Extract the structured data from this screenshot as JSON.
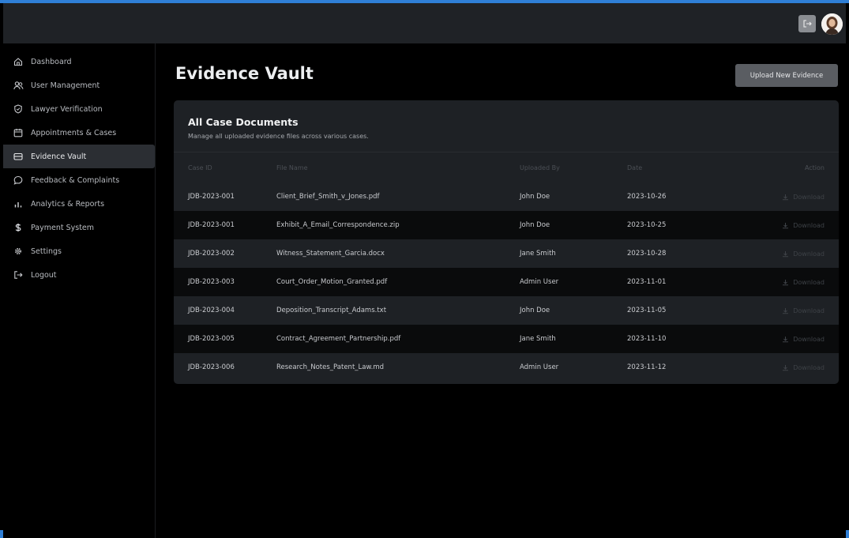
{
  "header": {
    "logout_icon": "logout-icon",
    "avatar_icon": "user-avatar"
  },
  "sidebar": {
    "items": [
      {
        "label": "Dashboard",
        "icon": "home-icon"
      },
      {
        "label": "User Management",
        "icon": "users-icon"
      },
      {
        "label": "Lawyer Verification",
        "icon": "shield-check-icon"
      },
      {
        "label": "Appointments & Cases",
        "icon": "calendar-icon"
      },
      {
        "label": "Evidence Vault",
        "icon": "vault-icon",
        "active": true
      },
      {
        "label": "Feedback & Complaints",
        "icon": "message-icon"
      },
      {
        "label": "Analytics & Reports",
        "icon": "bar-chart-icon"
      },
      {
        "label": "Payment System",
        "icon": "dollar-icon"
      },
      {
        "label": "Settings",
        "icon": "gear-icon"
      },
      {
        "label": "Logout",
        "icon": "logout-icon"
      }
    ]
  },
  "main": {
    "title": "Evidence Vault",
    "upload_button": "Upload New Evidence"
  },
  "card": {
    "title": "All Case Documents",
    "subtitle": "Manage all uploaded evidence files across various cases."
  },
  "table": {
    "headers": [
      "Case ID",
      "File Name",
      "Uploaded By",
      "Date",
      "Action"
    ],
    "rows": [
      {
        "case_id": "JDB-2023-001",
        "file": "Client_Brief_Smith_v_Jones.pdf",
        "by": "John Doe",
        "date": "2023-10-26",
        "action": "Download"
      },
      {
        "case_id": "JDB-2023-001",
        "file": "Exhibit_A_Email_Correspondence.zip",
        "by": "John Doe",
        "date": "2023-10-25",
        "action": "Download"
      },
      {
        "case_id": "JDB-2023-002",
        "file": "Witness_Statement_Garcia.docx",
        "by": "Jane Smith",
        "date": "2023-10-28",
        "action": "Download"
      },
      {
        "case_id": "JDB-2023-003",
        "file": "Court_Order_Motion_Granted.pdf",
        "by": "Admin User",
        "date": "2023-11-01",
        "action": "Download"
      },
      {
        "case_id": "JDB-2023-004",
        "file": "Deposition_Transcript_Adams.txt",
        "by": "John Doe",
        "date": "2023-11-05",
        "action": "Download"
      },
      {
        "case_id": "JDB-2023-005",
        "file": "Contract_Agreement_Partnership.pdf",
        "by": "Jane Smith",
        "date": "2023-11-10",
        "action": "Download"
      },
      {
        "case_id": "JDB-2023-006",
        "file": "Research_Notes_Patent_Law.md",
        "by": "Admin User",
        "date": "2023-11-12",
        "action": "Download"
      }
    ]
  },
  "colors": {
    "accent": "#2f7fd6",
    "topbar": "#1f2226",
    "card": "#1e2125",
    "active_nav": "#2b2e33",
    "upload_button": "#5a5d62"
  }
}
